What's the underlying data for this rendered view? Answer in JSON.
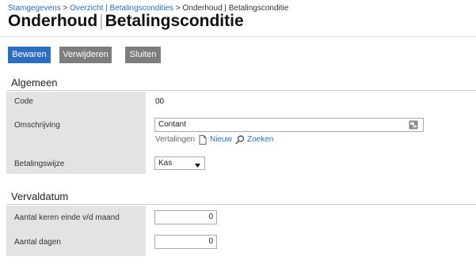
{
  "breadcrumb": {
    "item1": "Stamgegevens",
    "sep1": ">",
    "item2": "Overzicht | Betalingscondities",
    "sep2": ">",
    "item3": "Onderhoud | Betalingsconditie"
  },
  "title": {
    "part1": "Onderhoud",
    "separator": "|",
    "part2": "Betalingsconditie"
  },
  "toolbar": {
    "save_label": "Bewaren",
    "delete_label": "Verwijderen",
    "close_label": "Sluiten"
  },
  "algemeen": {
    "heading": "Algemeen",
    "code_label": "Code",
    "code_value": "00",
    "omschrijving_label": "Omschrijving",
    "omschrijving_value": "Contant",
    "translations_label": "Vertalingen",
    "new_label": "Nieuw",
    "search_label": "Zoeken",
    "betalingswijze_label": "Betalingswijze",
    "betalingswijze_value": "Kas"
  },
  "vervaldatum": {
    "heading": "Vervaldatum",
    "aantal_keren_label": "Aantal keren einde v/d maand",
    "aantal_keren_value": "0",
    "aantal_dagen_label": "Aantal dagen",
    "aantal_dagen_value": "0"
  },
  "colors": {
    "primary": "#2d6fbe",
    "secondary": "#7d7d7d",
    "label_bg": "#e3e3e3",
    "link": "#2a6fb0"
  },
  "icons": {
    "translate": "translate-icon",
    "new": "document-icon",
    "search": "magnifier-icon",
    "dropdown": "caret-down-icon"
  }
}
